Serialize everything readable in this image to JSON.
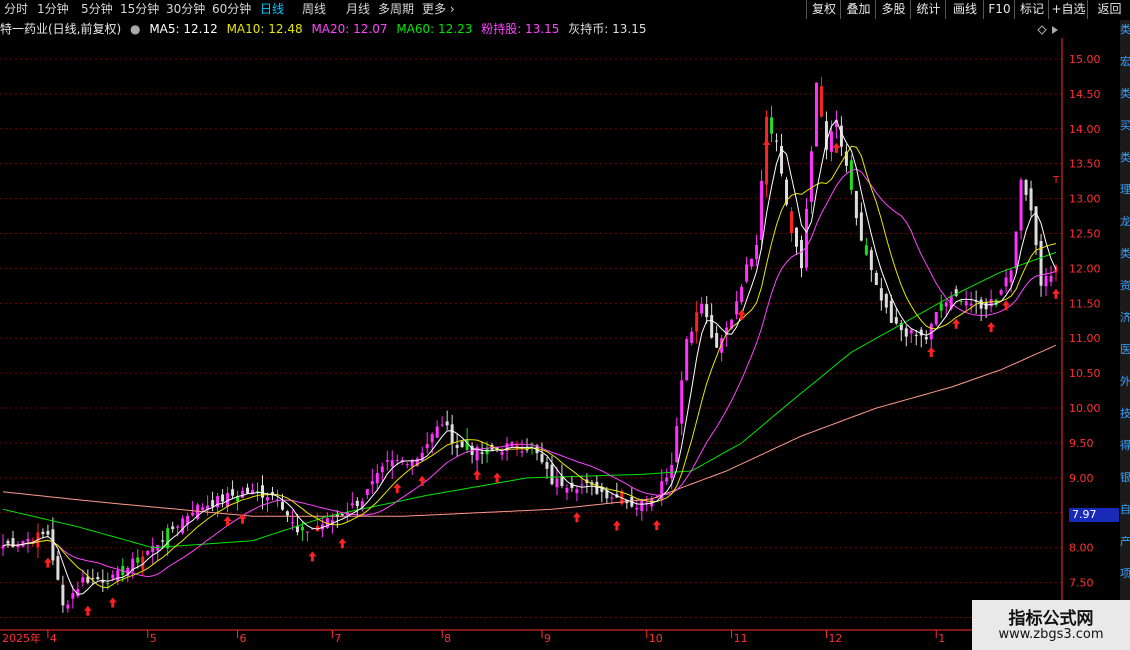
{
  "periods": [
    {
      "label": "分时",
      "active": false
    },
    {
      "label": "1分钟",
      "active": false
    },
    {
      "label": "5分钟",
      "active": false
    },
    {
      "label": "15分钟",
      "active": false
    },
    {
      "label": "30分钟",
      "active": false
    },
    {
      "label": "60分钟",
      "active": false
    },
    {
      "label": "日线",
      "active": true
    },
    {
      "label": "周线",
      "active": false
    },
    {
      "label": "月线",
      "active": false
    },
    {
      "label": "多周期",
      "active": false
    },
    {
      "label": "更多",
      "active": false
    }
  ],
  "toolbar": [
    "复权",
    "叠加",
    "多股",
    "统计",
    "画线",
    "F10",
    "标记",
    "+自选",
    "返回"
  ],
  "info": {
    "stock_name": "特一药业(日线,前复权)",
    "ma5": "MA5: 12.12",
    "ma10": "MA10: 12.48",
    "ma20": "MA20: 12.07",
    "ma60": "MA60: 12.23",
    "pink": "粉持股: 13.15",
    "grey": "灰持币: 13.15"
  },
  "colors": {
    "ma5": "#ffffff",
    "ma10": "#e6e600",
    "ma20": "#ff44ff",
    "ma60": "#00e600",
    "ma_long": "#ff9a8a",
    "up": "#ff33ff",
    "down": "#dddddd",
    "up_red": "#ff2222",
    "down_green": "#22dd22",
    "arrow": "#ff2020",
    "axis": "#ff3030",
    "grid": "#7a0000"
  },
  "current_price": "7.97",
  "right_strip_chars": [
    "类",
    "宏",
    "类",
    "买",
    "类",
    "理",
    "龙",
    "类",
    "资",
    "济",
    "医",
    "外",
    "技",
    "得",
    "银",
    "自",
    "产",
    "项",
    "顶"
  ],
  "watermark": {
    "title": "指标公式网",
    "url": "www.zbgs3.com"
  },
  "chart_data": {
    "type": "candlestick",
    "y_ticks": [
      15,
      14.5,
      14,
      13.5,
      13,
      12.5,
      12,
      11.5,
      11,
      10.5,
      10,
      9.5,
      9,
      8.5,
      8,
      7.5,
      7
    ],
    "ylim": [
      6.85,
      15.3
    ],
    "x_month_labels": [
      {
        "label": "2025年",
        "index": 0
      },
      {
        "label": "4",
        "index": 9
      },
      {
        "label": "5",
        "index": 29
      },
      {
        "label": "6",
        "index": 47
      },
      {
        "label": "7",
        "index": 66
      },
      {
        "label": "8",
        "index": 88
      },
      {
        "label": "9",
        "index": 108
      },
      {
        "label": "10",
        "index": 129
      },
      {
        "label": "11",
        "index": 146
      },
      {
        "label": "12",
        "index": 165
      },
      {
        "label": "1",
        "index": 187
      }
    ],
    "key_prices": [
      {
        "x": 1,
        "y": 8.05
      },
      {
        "x": 9,
        "y": 8.2
      },
      {
        "x": 12,
        "y": 7.15
      },
      {
        "x": 16,
        "y": 7.55
      },
      {
        "x": 22,
        "y": 7.55
      },
      {
        "x": 30,
        "y": 8.0
      },
      {
        "x": 38,
        "y": 8.55
      },
      {
        "x": 48,
        "y": 8.8
      },
      {
        "x": 55,
        "y": 8.75
      },
      {
        "x": 59,
        "y": 8.2
      },
      {
        "x": 66,
        "y": 8.4
      },
      {
        "x": 72,
        "y": 8.7
      },
      {
        "x": 77,
        "y": 9.2
      },
      {
        "x": 83,
        "y": 9.3
      },
      {
        "x": 88,
        "y": 9.8
      },
      {
        "x": 91,
        "y": 9.45
      },
      {
        "x": 96,
        "y": 9.35
      },
      {
        "x": 101,
        "y": 9.45
      },
      {
        "x": 106,
        "y": 9.45
      },
      {
        "x": 110,
        "y": 8.95
      },
      {
        "x": 116,
        "y": 8.9
      },
      {
        "x": 122,
        "y": 8.75
      },
      {
        "x": 127,
        "y": 8.6
      },
      {
        "x": 131,
        "y": 8.8
      },
      {
        "x": 134,
        "y": 9.2
      },
      {
        "x": 137,
        "y": 11.0
      },
      {
        "x": 140,
        "y": 11.5
      },
      {
        "x": 143,
        "y": 10.8
      },
      {
        "x": 146,
        "y": 11.3
      },
      {
        "x": 148,
        "y": 11.8
      },
      {
        "x": 151,
        "y": 12.4
      },
      {
        "x": 153,
        "y": 14.2
      },
      {
        "x": 155,
        "y": 13.8
      },
      {
        "x": 158,
        "y": 12.5
      },
      {
        "x": 160,
        "y": 12.0
      },
      {
        "x": 163,
        "y": 14.6
      },
      {
        "x": 165,
        "y": 13.7
      },
      {
        "x": 167,
        "y": 14.1
      },
      {
        "x": 169,
        "y": 13.4
      },
      {
        "x": 172,
        "y": 12.4
      },
      {
        "x": 175,
        "y": 11.7
      },
      {
        "x": 178,
        "y": 11.2
      },
      {
        "x": 182,
        "y": 11.05
      },
      {
        "x": 185,
        "y": 11.0
      },
      {
        "x": 188,
        "y": 11.5
      },
      {
        "x": 192,
        "y": 11.6
      },
      {
        "x": 196,
        "y": 11.4
      },
      {
        "x": 199,
        "y": 11.6
      },
      {
        "x": 202,
        "y": 12.0
      },
      {
        "x": 204,
        "y": 13.2
      },
      {
        "x": 206,
        "y": 12.9
      },
      {
        "x": 208,
        "y": 11.8
      },
      {
        "x": 211,
        "y": 12.0
      }
    ],
    "ma_anchors": {
      "ma60": [
        {
          "x": 0,
          "y": 8.55
        },
        {
          "x": 15,
          "y": 8.3
        },
        {
          "x": 30,
          "y": 8.0
        },
        {
          "x": 50,
          "y": 8.1
        },
        {
          "x": 65,
          "y": 8.45
        },
        {
          "x": 85,
          "y": 8.75
        },
        {
          "x": 105,
          "y": 9.0
        },
        {
          "x": 128,
          "y": 9.05
        },
        {
          "x": 138,
          "y": 9.1
        },
        {
          "x": 148,
          "y": 9.5
        },
        {
          "x": 158,
          "y": 10.1
        },
        {
          "x": 170,
          "y": 10.8
        },
        {
          "x": 180,
          "y": 11.2
        },
        {
          "x": 190,
          "y": 11.6
        },
        {
          "x": 200,
          "y": 11.95
        },
        {
          "x": 211,
          "y": 12.23
        }
      ],
      "ma_long": [
        {
          "x": 0,
          "y": 8.8
        },
        {
          "x": 20,
          "y": 8.65
        },
        {
          "x": 50,
          "y": 8.45
        },
        {
          "x": 80,
          "y": 8.45
        },
        {
          "x": 110,
          "y": 8.55
        },
        {
          "x": 130,
          "y": 8.7
        },
        {
          "x": 145,
          "y": 9.1
        },
        {
          "x": 160,
          "y": 9.6
        },
        {
          "x": 175,
          "y": 10.0
        },
        {
          "x": 190,
          "y": 10.3
        },
        {
          "x": 200,
          "y": 10.55
        },
        {
          "x": 211,
          "y": 10.9
        }
      ]
    },
    "signal_indices": [
      9,
      17,
      22,
      45,
      48,
      62,
      68,
      79,
      84,
      95,
      99,
      115,
      123,
      131,
      148,
      153,
      167,
      186,
      191,
      198,
      201,
      211
    ]
  }
}
